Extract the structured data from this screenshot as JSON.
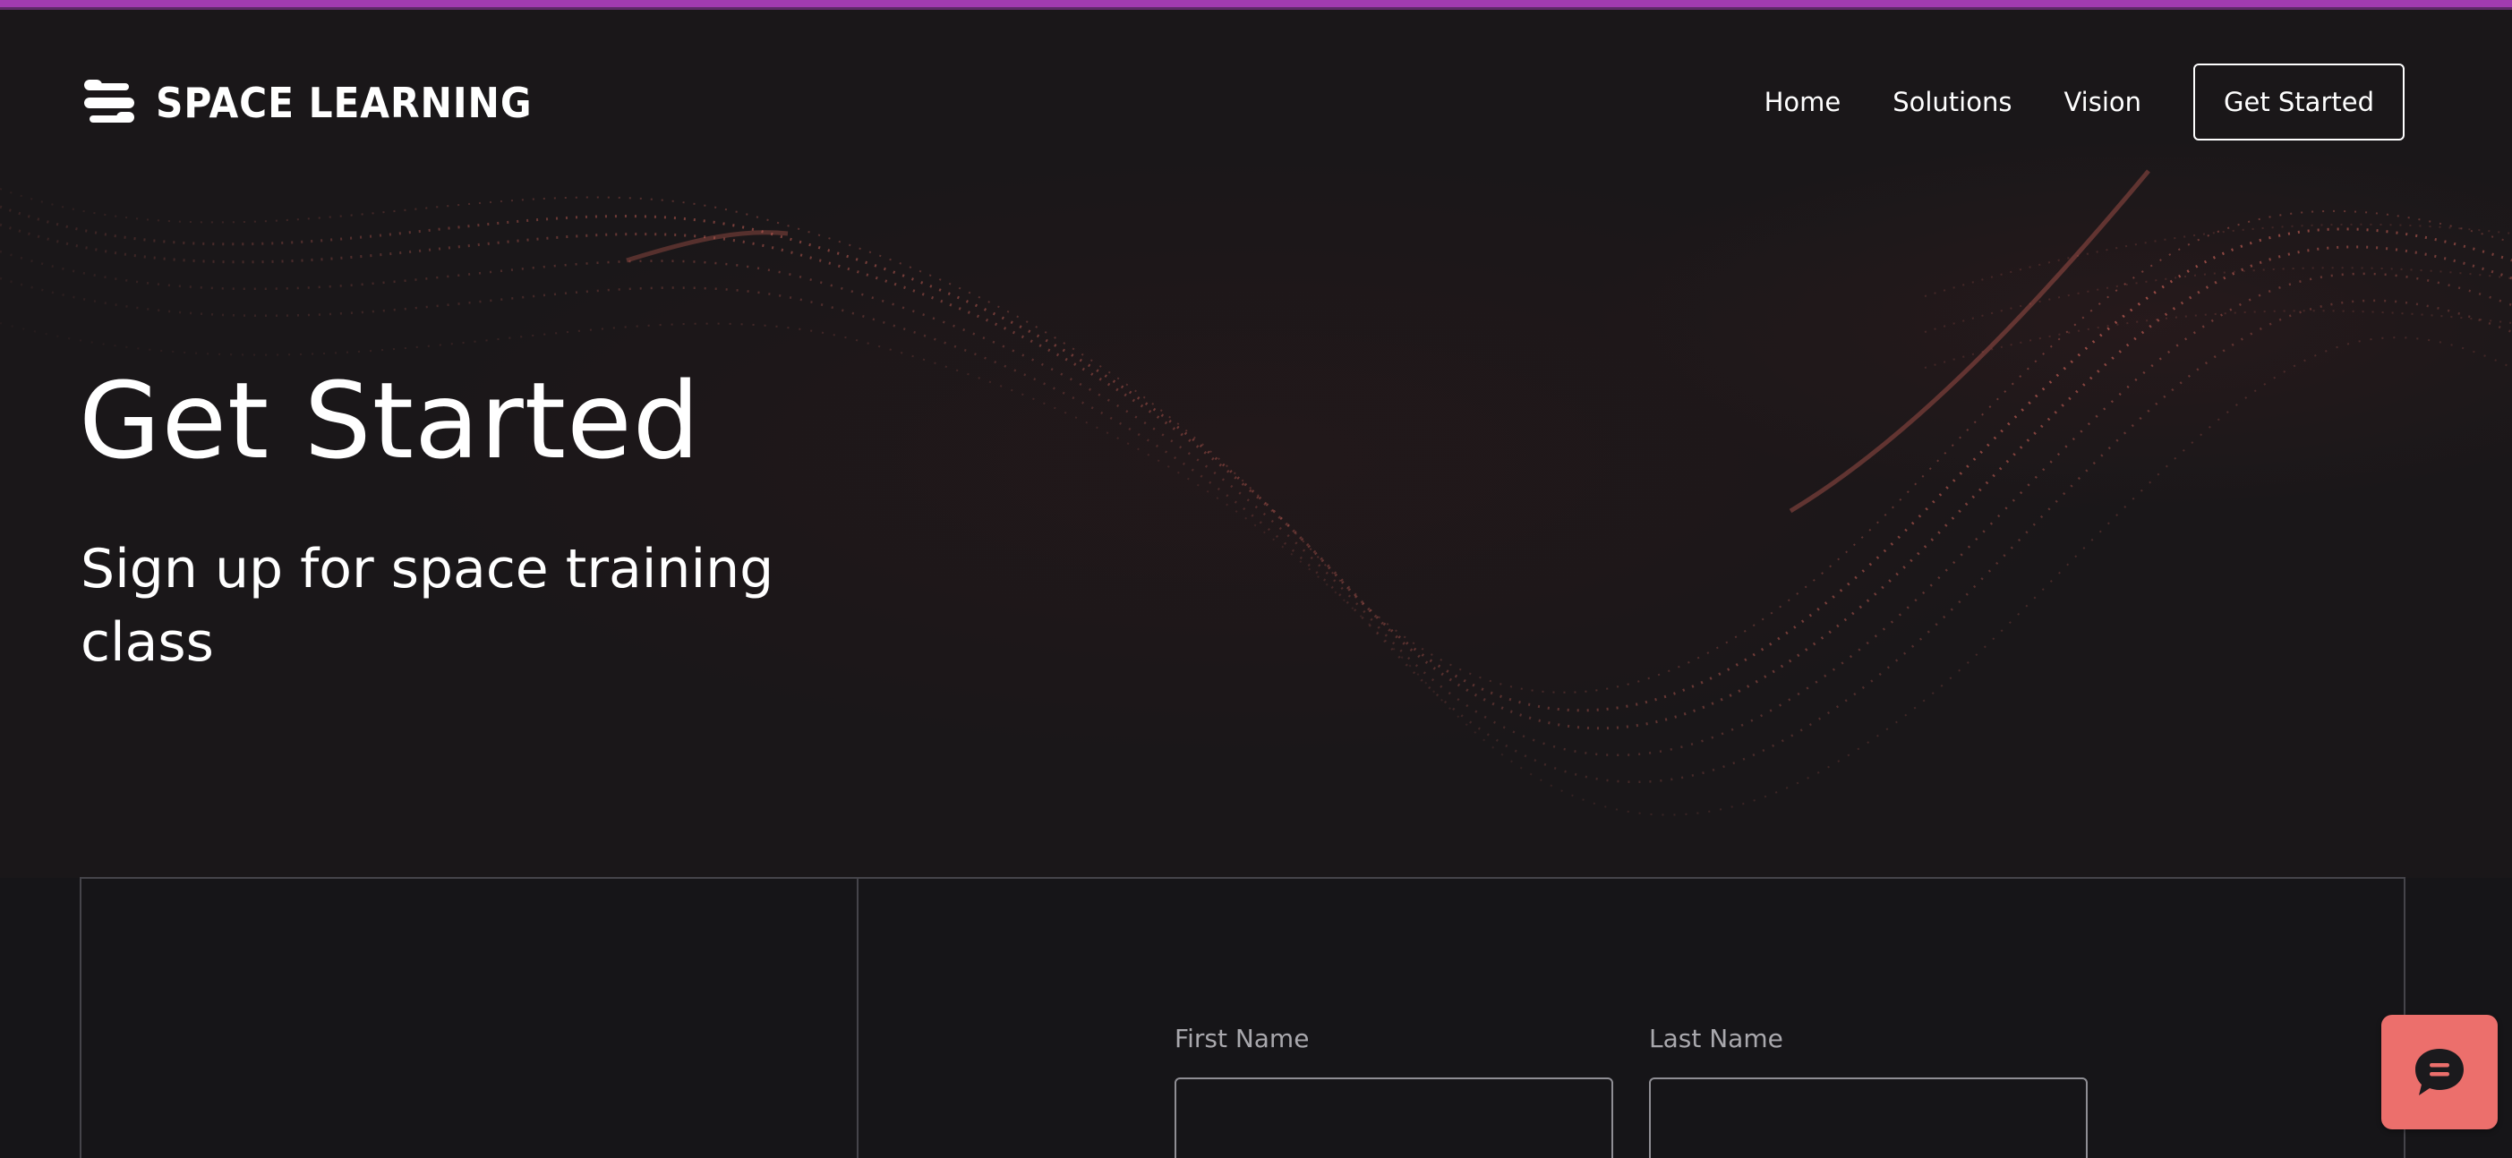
{
  "brand": {
    "name": "SPACE LEARNING"
  },
  "nav": {
    "items": [
      {
        "label": "Home"
      },
      {
        "label": "Solutions"
      },
      {
        "label": "Vision"
      }
    ],
    "cta_label": "Get Started"
  },
  "hero": {
    "title": "Get Started",
    "subtitle": "Sign up for space training class"
  },
  "form": {
    "first_name_label": "First Name",
    "last_name_label": "Last Name",
    "first_name_value": "",
    "last_name_value": ""
  },
  "chat": {
    "icon": "chat-bubble-icon"
  },
  "colors": {
    "background": "#161518",
    "top_accent": "#a13bb0",
    "wave": "#e06a5e",
    "chat_button": "#ec6f6c",
    "text": "#ffffff",
    "label": "#a9a8ad",
    "border": "#45444a"
  }
}
